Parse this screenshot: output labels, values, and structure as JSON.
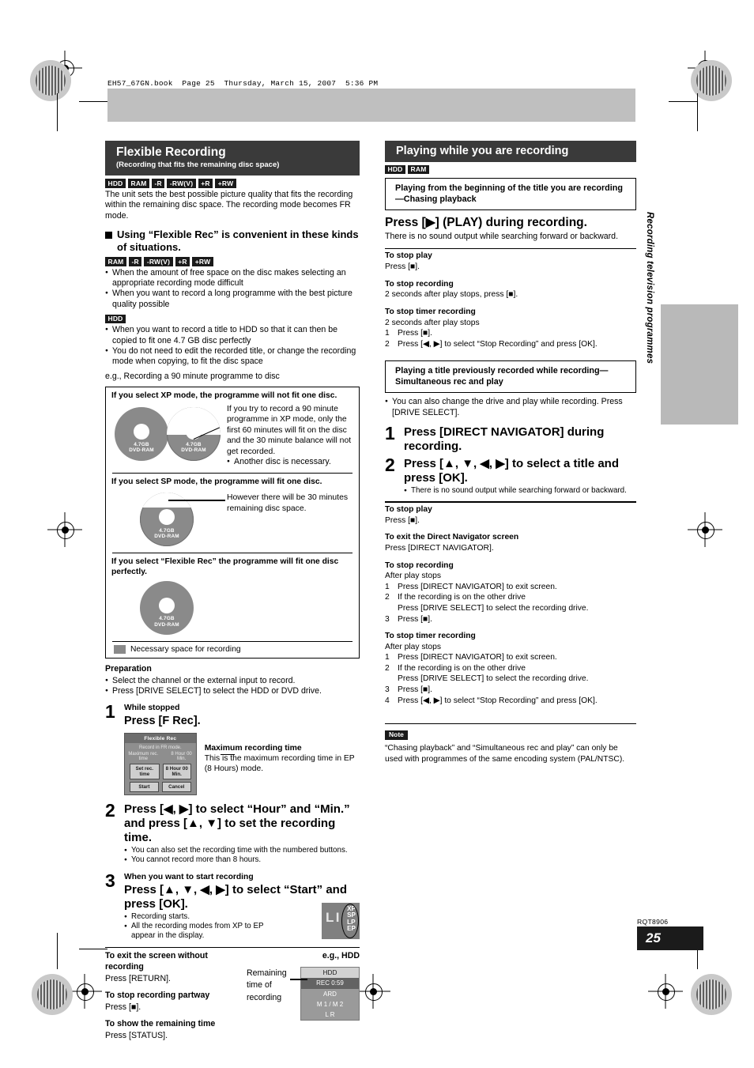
{
  "file_header": "EH57_67GN.book  Page 25  Thursday, March 15, 2007  5:36 PM",
  "side_tab": "Recording television programmes",
  "footer": {
    "code": "RQT8906",
    "page": "25"
  },
  "left": {
    "banner": {
      "title": "Flexible Recording",
      "subtitle": "(Recording that fits the remaining disc space)"
    },
    "tags": [
      "HDD",
      "RAM",
      "-R",
      "-RW(V)",
      "+R",
      "+RW"
    ],
    "intro": "The unit sets the best possible picture quality that fits the recording within the remaining disc space. The recording mode becomes FR mode.",
    "heading": "Using “Flexible Rec” is convenient in these kinds of situations.",
    "tags2": [
      "RAM",
      "-R",
      "-RW(V)",
      "+R",
      "+RW"
    ],
    "bullets2": [
      "When the amount of free space on the disc makes selecting an appropriate recording mode difficult",
      "When you want to record a long programme with the best picture quality possible"
    ],
    "tags3": [
      "HDD"
    ],
    "bullets3": [
      "When you want to record a title to HDD so that it can then be copied to fit one 4.7 GB disc perfectly",
      "You do not need to edit the recorded title, or change the recording mode when copying, to fit the disc space"
    ],
    "eg": "e.g., Recording a 90 minute programme to disc",
    "illustration": {
      "cap_xp": "If you select XP mode, the programme will not fit one disc.",
      "xp_text": "If you try to record a 90 minute programme in XP mode, only the first 60 minutes will fit on the disc and the 30 minute balance will not get recorded.",
      "xp_bullet": "Another disc is necessary.",
      "cap_sp": "If you select SP mode, the programme will fit one disc.",
      "sp_text": "However there will be 30 minutes remaining disc space.",
      "cap_fr": "If you select “Flexible Rec” the programme will fit one disc perfectly.",
      "disc_label_top": "4.7GB",
      "disc_label_bottom": "DVD-RAM",
      "legend": "Necessary space for recording"
    },
    "preparation": {
      "title": "Preparation",
      "items": [
        "Select the channel or the external input to record.",
        "Press [DRIVE SELECT] to select the HDD or DVD drive."
      ]
    },
    "steps": [
      {
        "num": "1",
        "pre": "While stopped",
        "cmd": "Press [F Rec]."
      },
      {
        "num": "2",
        "pre": "",
        "cmd": "Press [◀, ▶] to select “Hour” and “Min.” and press [▲, ▼] to set the recording time.",
        "bullets": [
          "You can also set the recording time with the numbered buttons.",
          "You cannot record more than 8 hours."
        ]
      },
      {
        "num": "3",
        "pre": "When you want to start recording",
        "cmd": "Press [▲, ▼, ◀, ▶] to select “Start” and press [OK].",
        "bullets": [
          "Recording starts.",
          "All the recording modes from XP to EP appear in the display."
        ]
      }
    ],
    "fr_dialog": {
      "title": "Flexible Rec",
      "subtitle": "Record in FR mode.",
      "max_label": "Maximum rec. time",
      "max_value": "8 Hour 00 Min.",
      "set_label": "Set rec. time",
      "set_value": "8 Hour 00 Min.",
      "start": "Start",
      "cancel": "Cancel"
    },
    "fr_note": {
      "title": "Maximum recording time",
      "text": "This is the maximum recording time in EP (8 Hours) mode."
    },
    "display_modes": [
      "XP",
      "SP",
      "LP",
      "EP"
    ],
    "bottom": {
      "exit_title": "To exit the screen without recording",
      "exit_text": "Press [RETURN].",
      "stop_title": "To stop recording partway",
      "stop_text": "Press [■].",
      "show_title": "To show the remaining time",
      "show_text": "Press [STATUS].",
      "eg_label": "e.g., HDD",
      "remaining_label": "Remaining time of recording",
      "osd": [
        "HDD",
        "REC 0:59",
        "ARD",
        "M 1 / M 2",
        "L R"
      ]
    }
  },
  "right": {
    "banner": {
      "title": "Playing while you are recording"
    },
    "tags": [
      "HDD",
      "RAM"
    ],
    "box1_title": "Playing from the beginning of the title you are recording—Chasing playback",
    "cmd1": "Press [▶] (PLAY) during recording.",
    "cmd1_note": "There is no sound output while searching forward or backward.",
    "sections1": [
      {
        "title": "To stop play",
        "lines": [
          "Press [■]."
        ]
      },
      {
        "title": "To stop recording",
        "lines": [
          "2 seconds after play stops, press [■]."
        ]
      },
      {
        "title": "To stop timer recording",
        "lines": [
          "2 seconds after play stops"
        ],
        "numbered": [
          "Press [■].",
          "Press [◀, ▶] to select “Stop Recording” and press [OK]."
        ]
      }
    ],
    "box2_title": "Playing a title previously recorded while recording—Simultaneous rec and play",
    "box2_bullet": "You can also change the drive and play while recording. Press [DRIVE SELECT].",
    "steps": [
      {
        "num": "1",
        "cmd": "Press [DIRECT NAVIGATOR] during recording."
      },
      {
        "num": "2",
        "cmd": "Press [▲, ▼, ◀, ▶] to select a title and press [OK].",
        "bullets": [
          "There is no sound output while searching forward or backward."
        ]
      }
    ],
    "sections2": [
      {
        "title": "To stop play",
        "lines": [
          "Press [■]."
        ]
      },
      {
        "title": "To exit the Direct Navigator screen",
        "lines": [
          "Press [DIRECT NAVIGATOR]."
        ]
      },
      {
        "title": "To stop recording",
        "lines": [
          "After play stops"
        ],
        "numbered": [
          "Press [DIRECT NAVIGATOR] to exit screen.",
          "If the recording is on the other drive\nPress [DRIVE SELECT] to select the recording drive.",
          "Press [■]."
        ]
      },
      {
        "title": "To stop timer recording",
        "lines": [
          "After play stops"
        ],
        "numbered": [
          "Press [DIRECT NAVIGATOR] to exit screen.",
          "If the recording is on the other drive\nPress [DRIVE SELECT] to select the recording drive.",
          "Press [■].",
          "Press [◀, ▶] to select “Stop Recording” and press [OK]."
        ]
      }
    ],
    "note_label": "Note",
    "note_text": "“Chasing playback” and “Simultaneous rec and play” can only be used with programmes of the same encoding system (PAL/NTSC)."
  }
}
